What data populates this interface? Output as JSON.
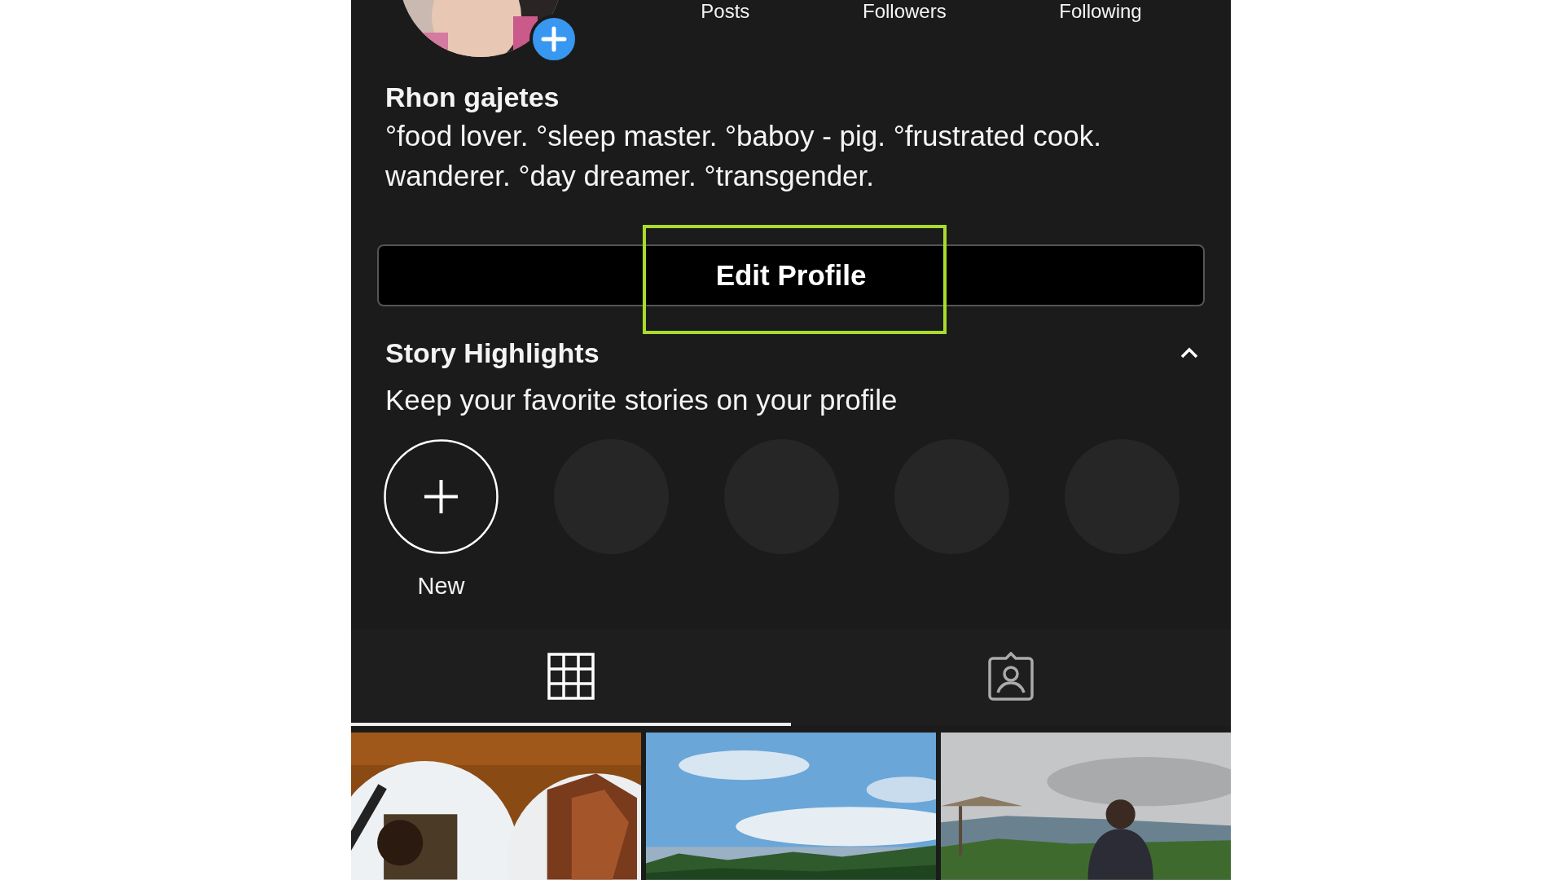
{
  "profile": {
    "stats": [
      {
        "label": "Posts"
      },
      {
        "label": "Followers"
      },
      {
        "label": "Following"
      }
    ],
    "name": "Rhon gajetes",
    "bio": [
      "°food lover. °sleep master. °baboy - pig. °frustrated cook.",
      "wanderer. °day dreamer. °transgender."
    ]
  },
  "edit_button": {
    "label": "Edit Profile"
  },
  "highlights": {
    "title": "Story Highlights",
    "subtitle": "Keep your favorite stories on your profile",
    "expanded": true,
    "items": [
      {
        "kind": "new",
        "label": "New"
      },
      {
        "kind": "empty"
      },
      {
        "kind": "empty"
      },
      {
        "kind": "empty"
      },
      {
        "kind": "empty"
      }
    ]
  },
  "tabs": [
    {
      "kind": "grid",
      "selected": true
    },
    {
      "kind": "tagged",
      "selected": false
    }
  ]
}
